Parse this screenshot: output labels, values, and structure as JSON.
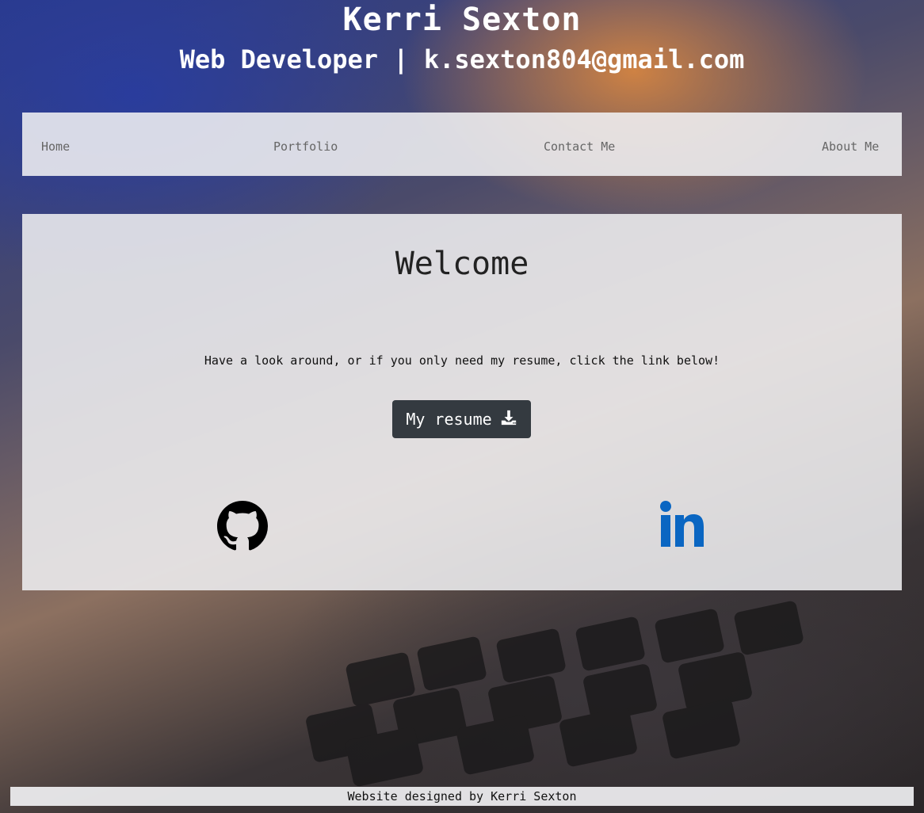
{
  "header": {
    "name": "Kerri Sexton",
    "subtitle": "Web Developer | k.sexton804@gmail.com"
  },
  "nav": {
    "items": [
      {
        "label": "Home"
      },
      {
        "label": "Portfolio"
      },
      {
        "label": "Contact Me"
      },
      {
        "label": "About Me"
      }
    ]
  },
  "main": {
    "title": "Welcome",
    "message": "Have a look around, or if you only need my resume, click the link below!",
    "resume_label": "My resume",
    "resume_icon": "download-icon",
    "social": [
      {
        "icon": "github-icon"
      },
      {
        "icon": "linkedin-icon",
        "color": "#0a66c2"
      }
    ]
  },
  "footer": {
    "text": "Website designed by Kerri Sexton"
  }
}
